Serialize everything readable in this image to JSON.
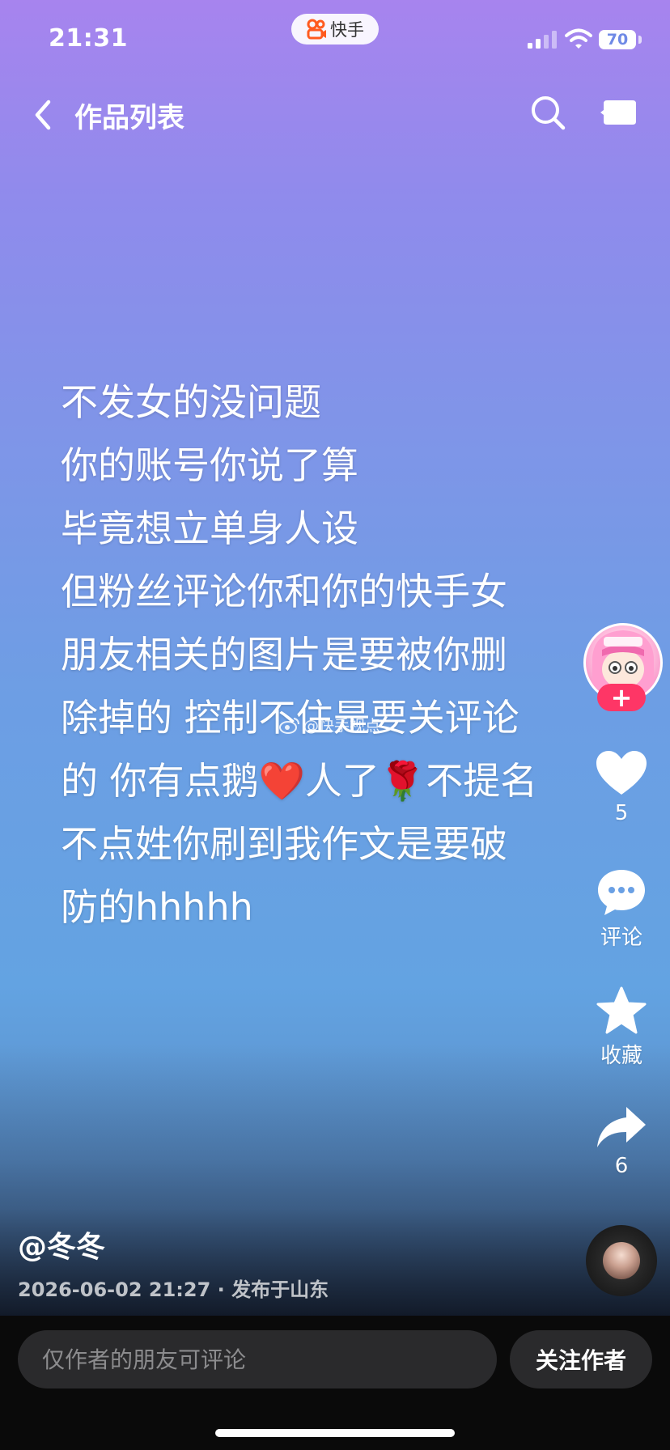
{
  "status_bar": {
    "time": "21:31",
    "app_badge": "快手",
    "battery": "70"
  },
  "nav": {
    "title": "作品列表",
    "icons": [
      "back-chevron-icon",
      "search-icon",
      "more-icon"
    ]
  },
  "post": {
    "lines": [
      "不发女的没问题",
      "你的账号你说了算",
      "毕竟想立单身人设",
      "但粉丝评论你和你的快手女",
      "朋友相关的图片是要被你删",
      "除掉的 控制不住是要关评论"
    ],
    "line7_a": "的 你有点鹅",
    "emoji_heart": "❤️",
    "line7_b": "人了",
    "emoji_rose": "🌹",
    "line7_c": "不提名",
    "line8": "不点姓你刷到我作文是要破",
    "line9": "防的hhhhh",
    "watermark": "@快手视点"
  },
  "rail": {
    "follow_plus": "+",
    "likes": "5",
    "comment_label": "评论",
    "favorite_label": "收藏",
    "shares": "6",
    "colors": {
      "follow": "#fe3666"
    }
  },
  "author": {
    "handle": "@冬冬",
    "meta": "2026-06-02 21:27 · 发布于山东"
  },
  "bottom": {
    "comment_placeholder": "仅作者的朋友可评论",
    "follow_label": "关注作者"
  }
}
